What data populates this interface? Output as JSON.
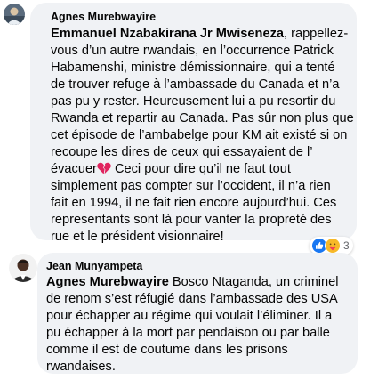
{
  "comments": [
    {
      "author": "Agnes Murebwayire",
      "mention": "Emmanuel Nzabakirana Jr Mwiseneza",
      "text_lines": [
        ", rappellez-",
        "vous d’un autre rwandais, en l’occurrence Patrick",
        "Habamenshi, ministre démissionnaire, qui a tenté",
        "de trouver refuge à l’ambassade du Canada et n’a",
        "pas pu y rester. Heureusement lui a pu resortir du",
        "Rwanda et repartir au Canada. Pas sûr non plus que",
        "cet épisode de l’ambabelge pour KM ait existé si on",
        "recoupe les dires de ceux qui essayaient de l’",
        "évacuer",
        " Ceci pour dire qu’il ne faut tout",
        "simplement pas compter sur l’occident, il n’a rien",
        "fait en 1994, il ne fait rien encore aujourd’hui. Ces",
        "representants sont là pour vanter la propreté des",
        "rue et le président visionnaire!"
      ],
      "emoji": "broken-heart-icon",
      "reactions": {
        "icons": [
          "like-icon",
          "care-icon"
        ],
        "count": "3"
      }
    },
    {
      "author": "Jean Munyampeta",
      "mention": "Agnes Murebwayire",
      "text_lines": [
        " Bosco Ntaganda, un criminel",
        "de renom s’est réfugié dans l’ambassade des USA",
        "pour échapper au régime qui voulait l’éliminer. Il a",
        "pu échapper à la mort par pendaison ou par balle",
        "comme il est de coutume dans les prisons",
        "rwandaises."
      ]
    }
  ],
  "colors": {
    "bubble": "#f0f2f5",
    "text": "#050505",
    "like_blue": "#1877f2",
    "care_yellow": "#f7b928",
    "broken_heart": "#e0245e"
  }
}
